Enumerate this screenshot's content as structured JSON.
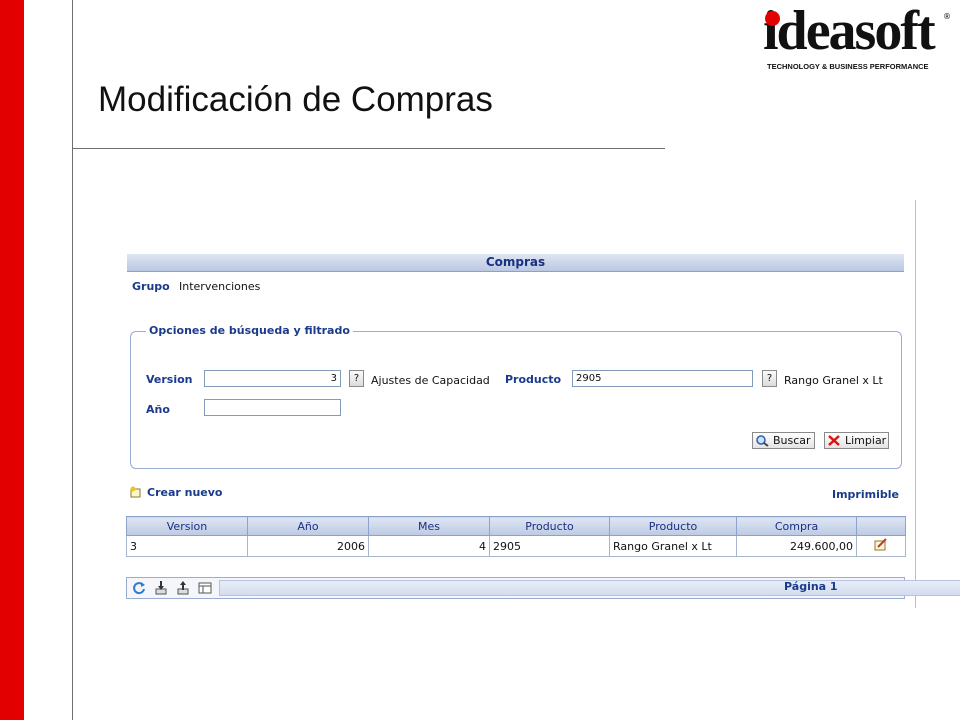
{
  "slide": {
    "title": "Modificación de Compras",
    "logo": {
      "word": "ideasoft",
      "registered": "®",
      "tagline": "TECHNOLOGY & BUSINESS PERFORMANCE"
    },
    "colors": {
      "accent_red": "#e20000",
      "app_blue": "#1a3a8c"
    }
  },
  "app": {
    "panel_title": "Compras",
    "grupo": {
      "label": "Grupo",
      "value": "Intervenciones"
    },
    "search": {
      "legend": "Opciones de búsqueda y filtrado",
      "version": {
        "label": "Version",
        "value": "3",
        "lookup": "?",
        "description": "Ajustes de Capacidad"
      },
      "producto": {
        "label": "Producto",
        "value": "2905",
        "lookup": "?",
        "description": "Rango Granel x Lt"
      },
      "anio": {
        "label": "Año",
        "value": ""
      },
      "buscar_label": "Buscar",
      "limpiar_label": "Limpiar"
    },
    "actions": {
      "crear_nuevo": "Crear nuevo",
      "imprimible": "Imprimible"
    },
    "table": {
      "headers": [
        "Version",
        "Año",
        "Mes",
        "Producto",
        "Producto",
        "Compra",
        ""
      ],
      "rows": [
        [
          "3",
          "2006",
          "4",
          "2905",
          "Rango Granel x Lt",
          "249.600,00",
          "edit-icon"
        ]
      ]
    },
    "pager": {
      "label": "Página 1",
      "icons": [
        "refresh-icon",
        "export-down-icon",
        "export-up-icon",
        "columns-icon"
      ]
    }
  }
}
